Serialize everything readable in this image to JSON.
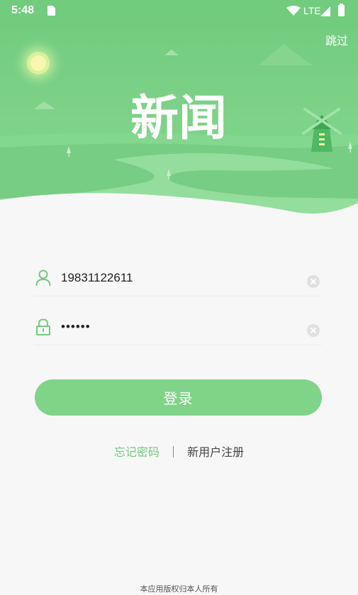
{
  "status_bar": {
    "time": "5:48",
    "network": "LTE",
    "icons": [
      "sd-card-icon",
      "wifi-icon",
      "signal-icon",
      "battery-icon"
    ]
  },
  "header": {
    "skip_label": "跳过",
    "logo_text": "新闻"
  },
  "form": {
    "phone_value": "19831122611",
    "password_value": "123456"
  },
  "login_button": {
    "label": "登录"
  },
  "links": {
    "forgot_password": "忘记密码",
    "register": "新用户注册"
  },
  "footer": {
    "text": "本应用版权归本人所有"
  },
  "colors": {
    "primary_green": "#7fd488",
    "status_bar_green": "#72cc7e",
    "link_green": "#6fcb7c"
  }
}
